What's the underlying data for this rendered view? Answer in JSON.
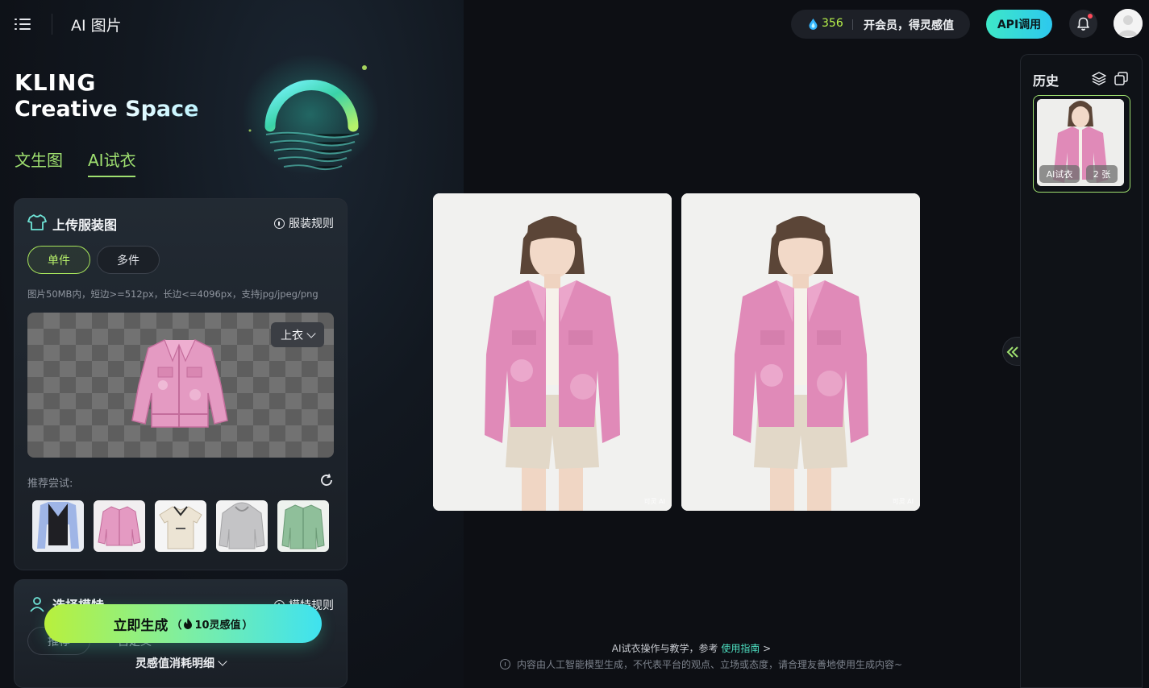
{
  "topbar": {
    "app_title": "AI 图片",
    "credits": "356",
    "member_text": "开会员，得灵感值",
    "api_label": "API调用"
  },
  "brand": {
    "line1": "KLING",
    "line2": "Creative Space"
  },
  "mode_tabs": [
    {
      "label": "文生图",
      "active": false
    },
    {
      "label": "AI试衣",
      "active": true
    }
  ],
  "upload": {
    "title": "上传服装图",
    "rule_label": "服装规则",
    "segments": [
      "单件",
      "多件"
    ],
    "selected_segment": "单件",
    "hint": "图片50MB内，短边>=512px，长边<=4096px，支持jpg/jpeg/png",
    "category": "上衣",
    "recommend_label": "推荐尝试:",
    "recommend_items": [
      "vest-and-shirt",
      "pink-denim-jacket",
      "polo-shirt",
      "gray-hoodie",
      "green-denim-jacket"
    ]
  },
  "model": {
    "title": "选择模特",
    "rule_label": "模特规则",
    "options": [
      "推荐",
      "自定义"
    ]
  },
  "generate": {
    "label": "立即生成",
    "cost_prefix": "（",
    "cost": "10灵感值",
    "cost_suffix": "）",
    "consume_label": "灵感值消耗明细"
  },
  "footer": {
    "tutorial_prefix": "AI试衣操作与教学，参考",
    "guide_label": "使用指南",
    "guide_arrow": ">",
    "disclaimer": "内容由人工智能模型生成，不代表平台的观点、立场或态度，请合理友善地使用生成内容~"
  },
  "results": {
    "watermark": "可灵 AI"
  },
  "history": {
    "title": "历史",
    "items": [
      {
        "type": "AI试衣",
        "count": "2 张"
      }
    ]
  },
  "colors": {
    "accent_green": "#9fe070",
    "accent_cyan": "#3fe2f0",
    "jacket_pink": "#e08ab8",
    "shorts_beige": "#e2d8c8"
  }
}
